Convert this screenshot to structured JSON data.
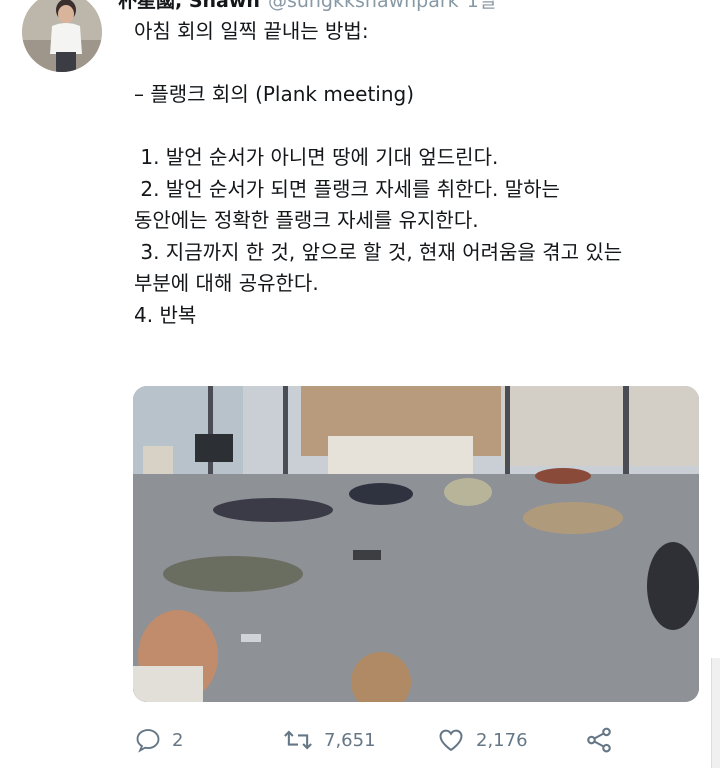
{
  "tweet": {
    "author_name": "朴星國, Shawn",
    "author_handle": "@sungkkshawnpark",
    "time": "1일",
    "lines": [
      "아침 회의 일찍 끝내는 방법:",
      "",
      "– 플랭크 회의 (Plank meeting)",
      "",
      " 1. 발언 순서가 아니면 땅에 기대 엎드린다.",
      " 2. 발언 순서가 되면 플랭크 자세를 취한다. 말하는",
      "동안에는 정확한 플랭크 자세를 유지한다.",
      " 3. 지금까지 한 것, 앞으로 할 것, 현재 어려움을 겪고 있는",
      "부분에 대해 공유한다.",
      "4. 반복"
    ]
  },
  "actions": {
    "replies": "2",
    "retweets": "7,651",
    "likes": "2,176"
  },
  "icons": {
    "reply": "comment-bubble-icon",
    "retweet": "retweet-icon",
    "like": "heart-icon",
    "share": "share-icon"
  },
  "colors": {
    "text": "#14171a",
    "muted": "#657786"
  }
}
